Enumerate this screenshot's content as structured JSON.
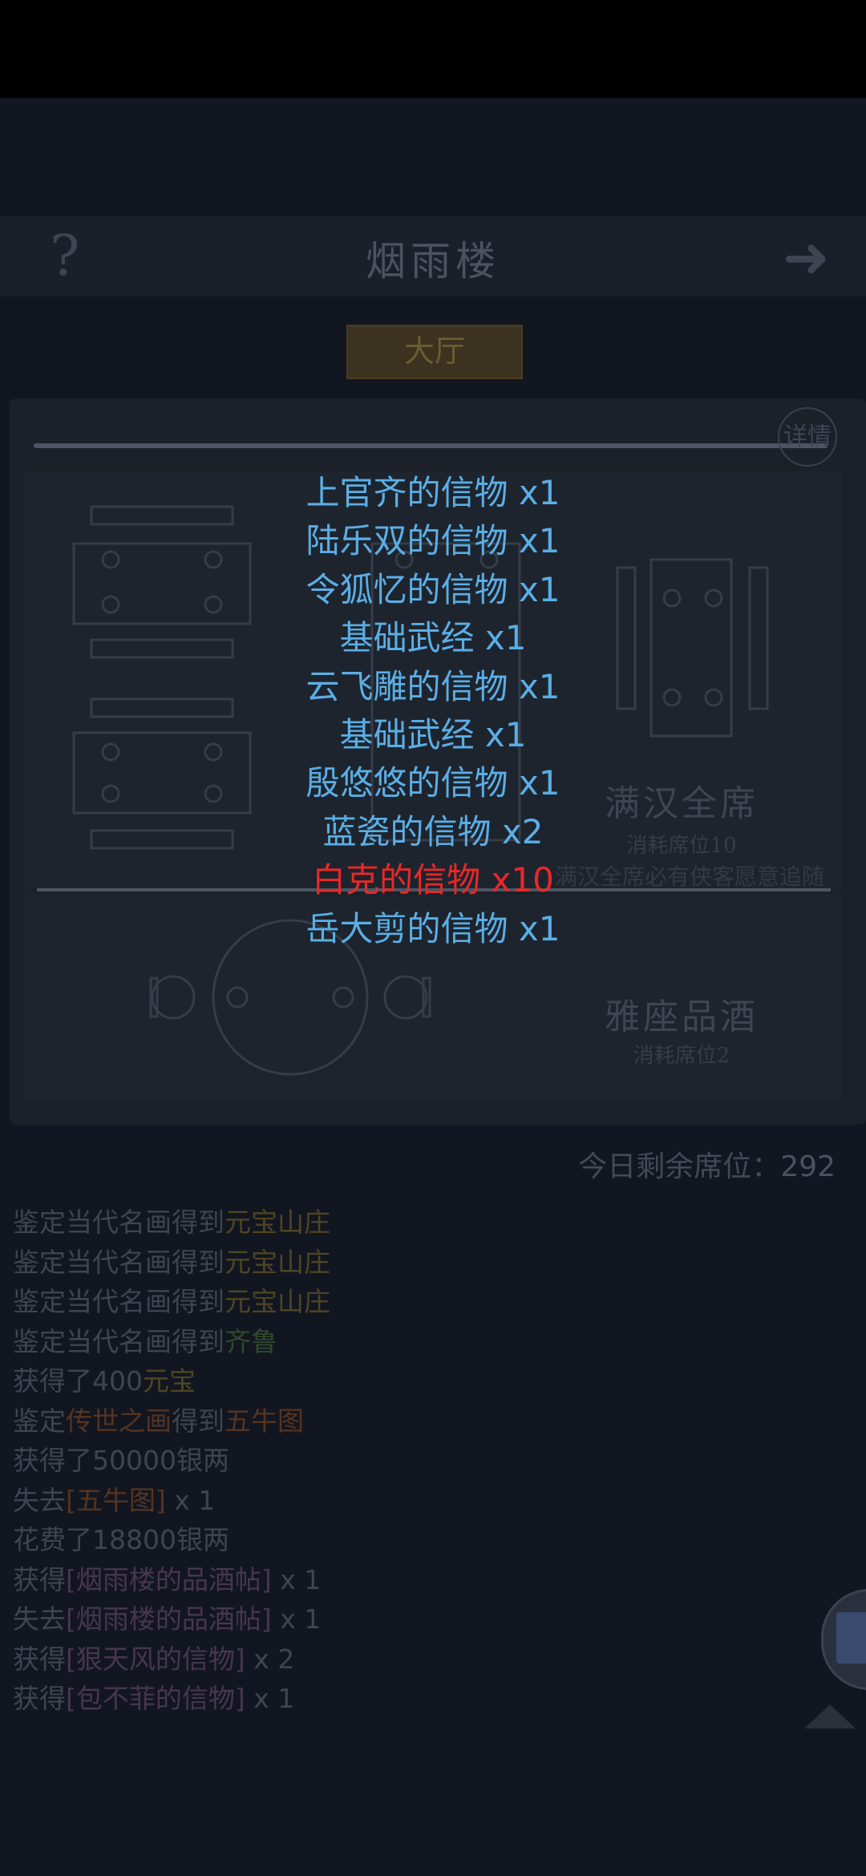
{
  "header": {
    "help_label": "?",
    "title": "烟雨楼",
    "next_label": "➜"
  },
  "tab": {
    "label": "大厅"
  },
  "details_label": "详情",
  "banquet_full": {
    "name": "满汉全席",
    "cost": "消耗席位10",
    "desc": "满汉全席必有侠客愿意追随"
  },
  "banquet_wine": {
    "name": "雅座品酒",
    "cost": "消耗席位2"
  },
  "remaining": {
    "label": "今日剩余席位：",
    "value": "292"
  },
  "log": [
    [
      {
        "t": "鉴定当代名画得到",
        "c": "gray"
      },
      {
        "t": "元宝山庄",
        "c": "yellow"
      }
    ],
    [
      {
        "t": "鉴定当代名画得到",
        "c": "gray"
      },
      {
        "t": "元宝山庄",
        "c": "yellow"
      }
    ],
    [
      {
        "t": "鉴定当代名画得到",
        "c": "gray"
      },
      {
        "t": "元宝山庄",
        "c": "yellow"
      }
    ],
    [
      {
        "t": "鉴定当代名画得到",
        "c": "gray"
      },
      {
        "t": "齐鲁",
        "c": "green"
      }
    ],
    [
      {
        "t": "获得了400",
        "c": "gray"
      },
      {
        "t": "元宝",
        "c": "yellow"
      }
    ],
    [
      {
        "t": "鉴定",
        "c": "gray"
      },
      {
        "t": "传世之画",
        "c": "orange"
      },
      {
        "t": "得到",
        "c": "gray"
      },
      {
        "t": "五牛图",
        "c": "orange"
      }
    ],
    [
      {
        "t": "获得了50000银两",
        "c": "gray"
      }
    ],
    [
      {
        "t": "失去",
        "c": "gray"
      },
      {
        "t": "[五牛图]",
        "c": "orange"
      },
      {
        "t": " x 1",
        "c": "gray"
      }
    ],
    [
      {
        "t": "花费了18800银两",
        "c": "gray"
      }
    ],
    [
      {
        "t": "获得",
        "c": "gray"
      },
      {
        "t": "[烟雨楼的品酒帖]",
        "c": "purple"
      },
      {
        "t": " x 1",
        "c": "gray"
      }
    ],
    [
      {
        "t": "失去",
        "c": "gray"
      },
      {
        "t": "[烟雨楼的品酒帖]",
        "c": "purple"
      },
      {
        "t": " x 1",
        "c": "gray"
      }
    ],
    [
      {
        "t": "获得",
        "c": "gray"
      },
      {
        "t": "[狠天风的信物]",
        "c": "purple"
      },
      {
        "t": " x 2",
        "c": "gray"
      }
    ],
    [
      {
        "t": "获得",
        "c": "gray"
      },
      {
        "t": "[包不菲的信物]",
        "c": "purple"
      },
      {
        "t": " x 1",
        "c": "gray"
      }
    ]
  ],
  "rewards": [
    {
      "name": "上官齐的信物",
      "qty": "x1",
      "color": "#5aaee6"
    },
    {
      "name": "陆乐双的信物",
      "qty": "x1",
      "color": "#5aaee6"
    },
    {
      "name": "令狐忆的信物",
      "qty": "x1",
      "color": "#5aaee6"
    },
    {
      "name": "基础武经",
      "qty": "x1",
      "color": "#5aaee6"
    },
    {
      "name": "云飞雕的信物",
      "qty": "x1",
      "color": "#5aaee6"
    },
    {
      "name": "基础武经",
      "qty": "x1",
      "color": "#5aaee6"
    },
    {
      "name": "殷悠悠的信物",
      "qty": "x1",
      "color": "#5aaee6"
    },
    {
      "name": "蓝瓷的信物",
      "qty": "x2",
      "color": "#5aaee6"
    },
    {
      "name": "白克的信物",
      "qty": "x10",
      "color": "#e82828"
    },
    {
      "name": "岳大剪的信物",
      "qty": "x1",
      "color": "#5aaee6"
    }
  ],
  "side_icon": "scroll-book-icon"
}
